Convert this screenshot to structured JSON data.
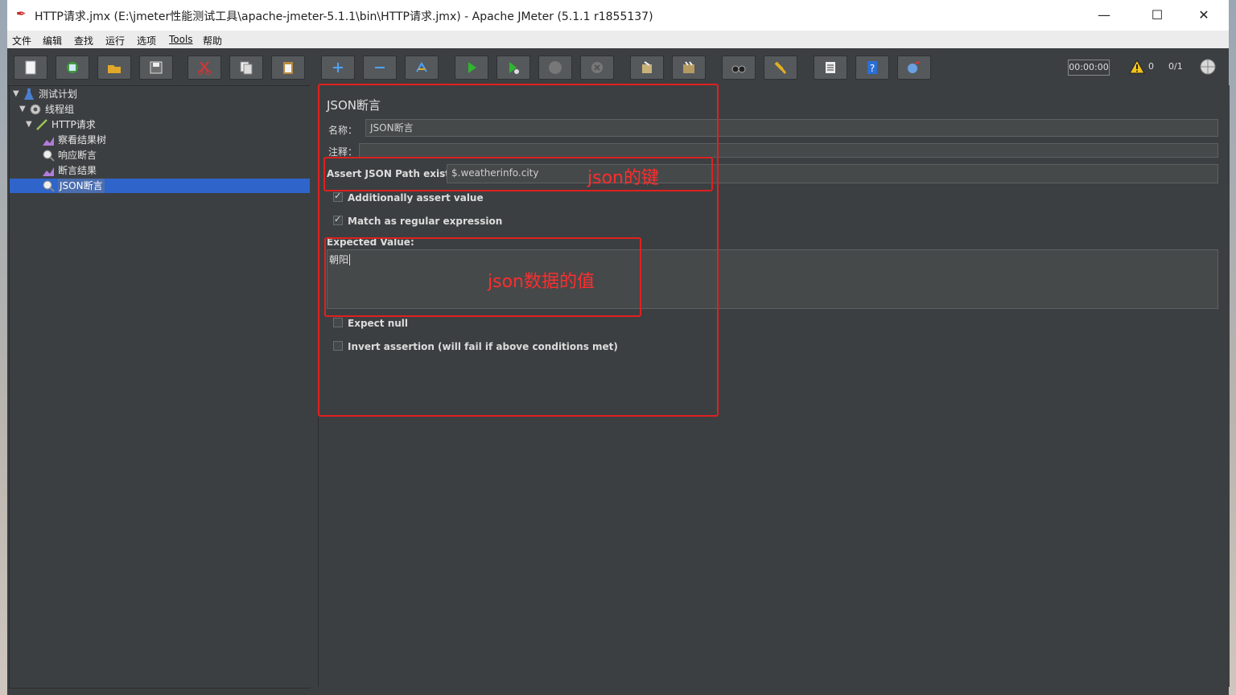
{
  "window": {
    "title": "HTTP请求.jmx (E:\\jmeter性能测试工具\\apache-jmeter-5.1.1\\bin\\HTTP请求.jmx) - Apache JMeter (5.1.1 r1855137)",
    "minimize": "—",
    "maximize": "☐",
    "close": "✕"
  },
  "menu": [
    "文件",
    "编辑",
    "查找",
    "运行",
    "选项",
    "Tools",
    "帮助"
  ],
  "toolbar": {
    "buttons": [
      "new-icon",
      "templates-icon",
      "open-icon",
      "save-icon",
      "cut-icon",
      "copy-icon",
      "paste-icon",
      "expand-icon",
      "collapse-icon",
      "toggle-icon",
      "start-icon",
      "start-no-pause-icon",
      "stop-icon",
      "shutdown-icon",
      "clear-icon",
      "clear-all-icon",
      "search-icon",
      "reset-search-icon",
      "function-helper-icon",
      "help-icon",
      "remote-icon"
    ],
    "timer": "00:00:00",
    "warnings": "0",
    "threads": "0/1"
  },
  "tree": {
    "nodes": [
      {
        "label": "测试计划",
        "icon": "test-plan-icon"
      },
      {
        "label": "线程组",
        "icon": "thread-group-icon"
      },
      {
        "label": "HTTP请求",
        "icon": "http-sampler-icon"
      },
      {
        "label": "察看结果树",
        "icon": "listener-icon"
      },
      {
        "label": "响应断言",
        "icon": "assertion-icon"
      },
      {
        "label": "断言结果",
        "icon": "listener-icon"
      },
      {
        "label": "JSON断言",
        "icon": "assertion-icon"
      }
    ]
  },
  "panel": {
    "heading": "JSON断言",
    "name_label": "名称：",
    "name_value": "JSON断言",
    "comment_label": "注释：",
    "comment_value": "",
    "path_label": "Assert JSON Path exists:",
    "path_value": "$.weatherinfo.city",
    "additionally_assert": {
      "label": "Additionally assert value",
      "checked": true
    },
    "match_regex": {
      "label": "Match as regular expression",
      "checked": true
    },
    "expected_label": "Expected Value:",
    "expected_value": "朝阳",
    "expect_null": {
      "label": "Expect null",
      "checked": false
    },
    "invert": {
      "label": "Invert assertion (will fail if above conditions met)",
      "checked": false
    }
  },
  "annotations": {
    "key_note": "json的键",
    "value_note": "json数据的值",
    "color": "#ff2d2d"
  }
}
